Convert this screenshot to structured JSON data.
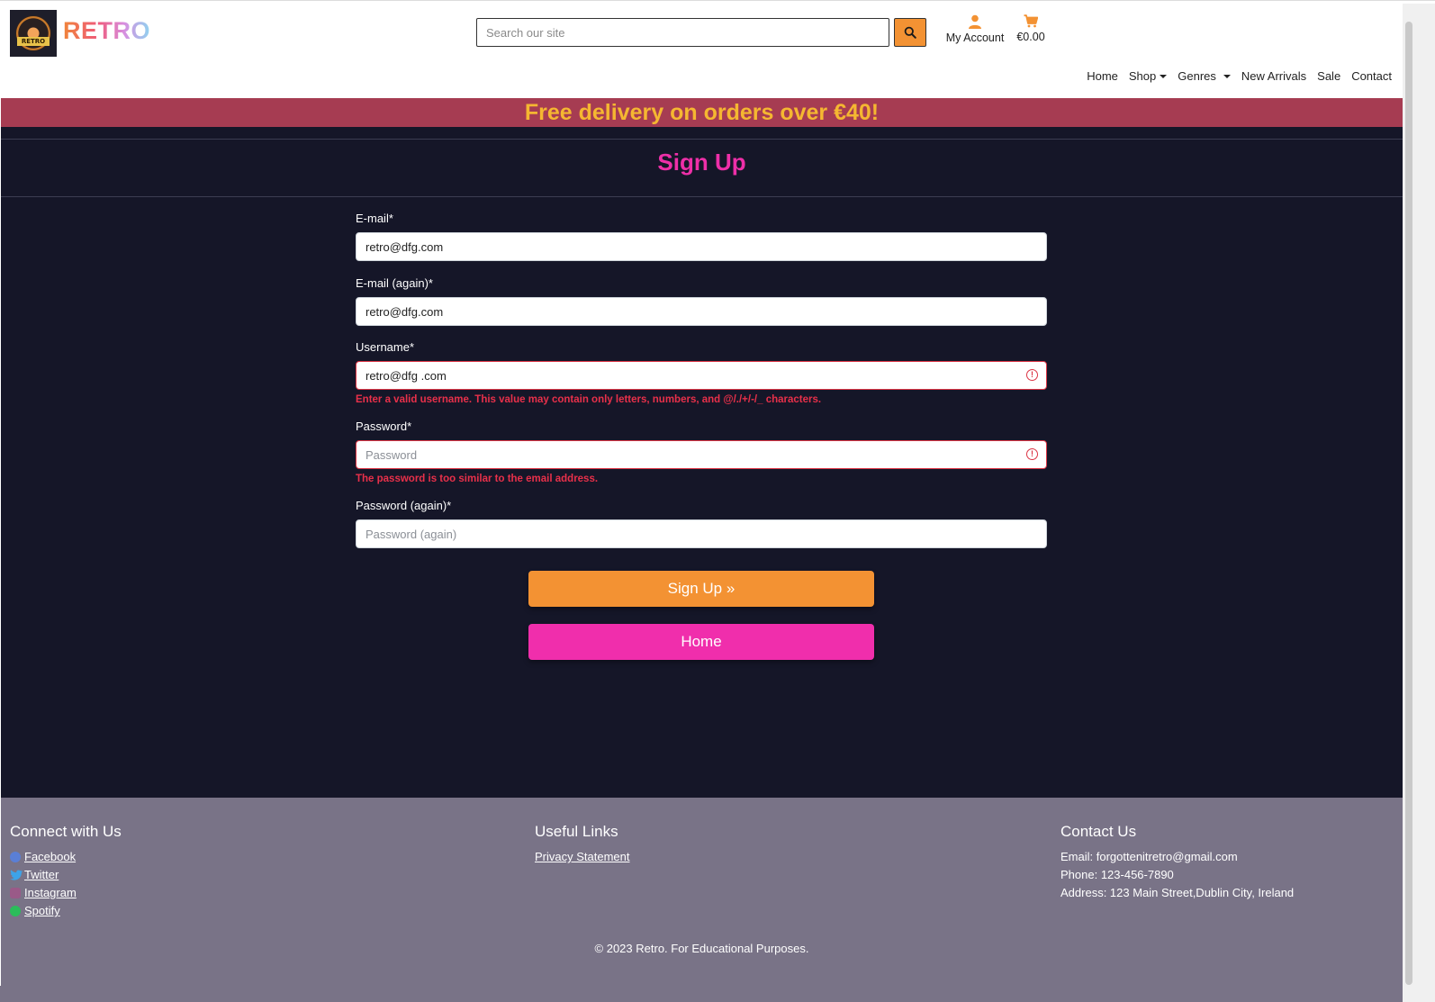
{
  "header": {
    "brand": "RETRO",
    "logo_text": "RETRO",
    "search_placeholder": "Search our site",
    "account_label": "My Account",
    "cart_total": "€0.00",
    "accent": "#f39233"
  },
  "nav": {
    "items": [
      {
        "label": "Home"
      },
      {
        "label": "Shop",
        "dropdown": true
      },
      {
        "label": "Genres",
        "dropdown": true
      },
      {
        "label": "New Arrivals"
      },
      {
        "label": "Sale"
      },
      {
        "label": "Contact"
      }
    ]
  },
  "banner": {
    "text": "Free delivery on orders over €40!",
    "bg": "#a63c52",
    "color": "#f5b731"
  },
  "page": {
    "title": "Sign Up"
  },
  "form": {
    "email": {
      "label": "E-mail*",
      "value": "retro@dfg.com"
    },
    "email2": {
      "label": "E-mail (again)*",
      "value": "retro@dfg.com"
    },
    "username": {
      "label": "Username*",
      "value": "retro@dfg .com",
      "error": "Enter a valid username. This value may contain only letters, numbers, and @/./+/-/_ characters."
    },
    "password": {
      "label": "Password*",
      "placeholder": "Password",
      "error": "The password is too similar to the email address."
    },
    "password2": {
      "label": "Password (again)*",
      "placeholder": "Password (again)"
    },
    "signup_button": "Sign Up »",
    "home_button": "Home"
  },
  "footer": {
    "connect": {
      "heading": "Connect with Us",
      "links": [
        {
          "label": " Facebook",
          "icon": "facebook-icon"
        },
        {
          "label": " Twitter",
          "icon": "twitter-icon"
        },
        {
          "label": " Instagram",
          "icon": "instagram-icon"
        },
        {
          "label": " Spotify",
          "icon": "spotify-icon"
        }
      ]
    },
    "useful": {
      "heading": "Useful Links",
      "links": [
        {
          "label": "Privacy Statement"
        }
      ]
    },
    "contact": {
      "heading": "Contact Us",
      "email": "Email: forgottenitretro@gmail.com",
      "phone": "Phone: 123-456-7890",
      "address": "Address: 123 Main Street,Dublin City, Ireland"
    },
    "copyright": "© 2023 Retro. For Educational Purposes."
  }
}
